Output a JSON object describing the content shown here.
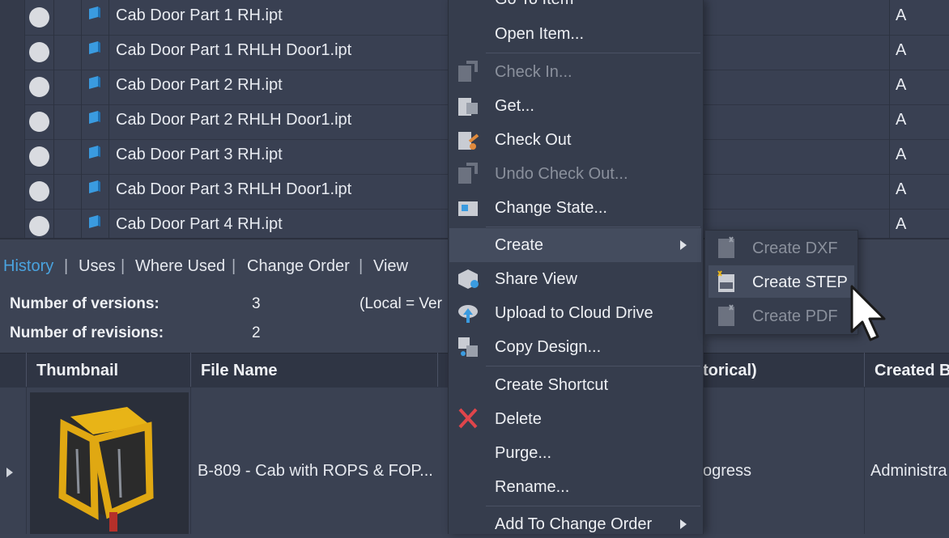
{
  "file_list": {
    "rows": [
      {
        "name": "Cab Door Part 1 RH.ipt",
        "state": "A"
      },
      {
        "name": "Cab Door Part 1 RHLH Door1.ipt",
        "state": "A"
      },
      {
        "name": "Cab Door Part 2 RH.ipt",
        "state": "A"
      },
      {
        "name": "Cab Door Part 2 RHLH Door1.ipt",
        "state": "A"
      },
      {
        "name": "Cab Door Part 3 RH.ipt",
        "state": "A"
      },
      {
        "name": "Cab Door Part 3 RHLH Door1.ipt",
        "state": "A"
      },
      {
        "name": "Cab Door Part 4 RH.ipt",
        "state": "A"
      }
    ]
  },
  "tabs": {
    "items": [
      "History",
      "Uses",
      "Where Used",
      "Change Order",
      "View"
    ],
    "active": "History",
    "separator": "|"
  },
  "history": {
    "versions_label": "Number of versions:",
    "versions_value": "3",
    "revisions_label": "Number of revisions:",
    "revisions_value": "2",
    "local_note": "(Local = Ver",
    "columns": [
      "Thumbnail",
      "File Name",
      "torical)",
      "Created B"
    ],
    "row": {
      "file_name": "B-809 - Cab with ROPS & FOP...",
      "state": "ogress",
      "created_by": "Administra"
    }
  },
  "context_menu": {
    "go_to_item": "Go To Item",
    "open_item": "Open Item...",
    "check_in": "Check In...",
    "get": "Get...",
    "check_out": "Check Out",
    "undo_check_out": "Undo Check Out...",
    "change_state": "Change State...",
    "create": "Create",
    "share_view": "Share View",
    "upload_cloud": "Upload to Cloud Drive",
    "copy_design": "Copy Design...",
    "create_shortcut": "Create Shortcut",
    "delete": "Delete",
    "purge": "Purge...",
    "rename": "Rename...",
    "add_to_change_order": "Add To Change Order"
  },
  "submenu": {
    "create_dxf": "Create DXF",
    "create_step": "Create STEP",
    "create_pdf": "Create PDF"
  },
  "colors": {
    "background": "#3b4253",
    "menu": "#363d4d",
    "highlight": "#444c5e",
    "active_tab": "#4aa3df",
    "delete_icon": "#e0454b",
    "cube": "#3a9be0"
  }
}
